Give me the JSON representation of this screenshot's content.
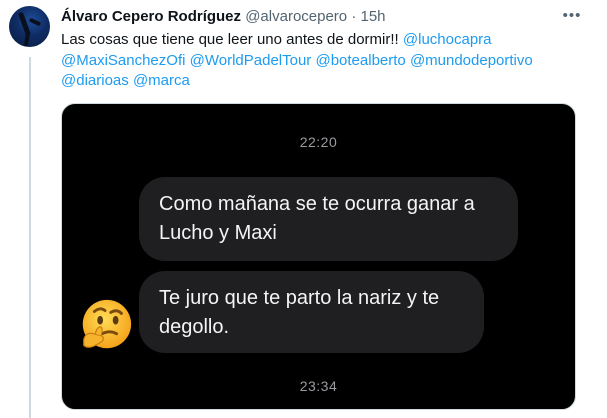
{
  "tweet": {
    "author_name": "Álvaro Cepero Rodríguez",
    "handle": "@alvarocepero",
    "separator": "·",
    "time": "15h",
    "text_prefix": "Las cosas que tiene que leer uno antes de dormir!! ",
    "mentions": [
      "@luchocapra",
      "@MaxiSanchezOfi",
      "@WorldPadelTour",
      "@botealberto",
      "@mundodeportivo",
      "@diarioas",
      "@marca"
    ],
    "more_icon": "ellipsis-icon"
  },
  "media": {
    "timestamp_top": "22:20",
    "message_1": "Como mañana se te ocurra ganar a Lucho y Maxi",
    "message_2": "Te juro que te parto la nariz y te degollo.",
    "emoji": "thinking-face-emoji",
    "timestamp_bottom": "23:34"
  },
  "colors": {
    "link": "#1d9bf0",
    "secondary_text": "#536471",
    "bubble": "#1f1f22",
    "media_bg": "#000000"
  }
}
